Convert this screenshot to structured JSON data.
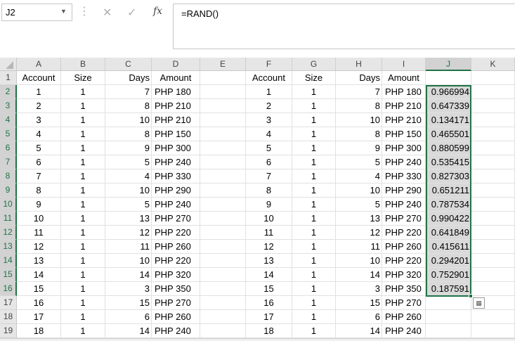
{
  "name_box": "J2",
  "formula": "=RAND()",
  "icons": {
    "cancel": "✕",
    "enter": "✓",
    "fx": "fx"
  },
  "columns": [
    "A",
    "B",
    "C",
    "D",
    "E",
    "F",
    "G",
    "H",
    "I",
    "J",
    "K"
  ],
  "headers": {
    "A": "Account",
    "B": "Size",
    "C": "Days",
    "D": "Amount",
    "F": "Account",
    "G": "Size",
    "H": "Days",
    "I": "Amount"
  },
  "rows": [
    {
      "n": "1",
      "A": "Account",
      "B": "Size",
      "C": "Days",
      "D": "Amount",
      "F": "Account",
      "G": "Size",
      "H": "Days",
      "I": "Amount",
      "J": ""
    },
    {
      "n": "2",
      "A": "1",
      "B": "1",
      "C": "7",
      "D": "PHP 180",
      "F": "1",
      "G": "1",
      "H": "7",
      "I": "PHP 180",
      "J": "0.966994"
    },
    {
      "n": "3",
      "A": "2",
      "B": "1",
      "C": "8",
      "D": "PHP 210",
      "F": "2",
      "G": "1",
      "H": "8",
      "I": "PHP 210",
      "J": "0.647339"
    },
    {
      "n": "4",
      "A": "3",
      "B": "1",
      "C": "10",
      "D": "PHP 210",
      "F": "3",
      "G": "1",
      "H": "10",
      "I": "PHP 210",
      "J": "0.134171"
    },
    {
      "n": "5",
      "A": "4",
      "B": "1",
      "C": "8",
      "D": "PHP 150",
      "F": "4",
      "G": "1",
      "H": "8",
      "I": "PHP 150",
      "J": "0.465501"
    },
    {
      "n": "6",
      "A": "5",
      "B": "1",
      "C": "9",
      "D": "PHP 300",
      "F": "5",
      "G": "1",
      "H": "9",
      "I": "PHP 300",
      "J": "0.880599"
    },
    {
      "n": "7",
      "A": "6",
      "B": "1",
      "C": "5",
      "D": "PHP 240",
      "F": "6",
      "G": "1",
      "H": "5",
      "I": "PHP 240",
      "J": "0.535415"
    },
    {
      "n": "8",
      "A": "7",
      "B": "1",
      "C": "4",
      "D": "PHP 330",
      "F": "7",
      "G": "1",
      "H": "4",
      "I": "PHP 330",
      "J": "0.827303"
    },
    {
      "n": "9",
      "A": "8",
      "B": "1",
      "C": "10",
      "D": "PHP 290",
      "F": "8",
      "G": "1",
      "H": "10",
      "I": "PHP 290",
      "J": "0.651211"
    },
    {
      "n": "10",
      "A": "9",
      "B": "1",
      "C": "5",
      "D": "PHP 240",
      "F": "9",
      "G": "1",
      "H": "5",
      "I": "PHP 240",
      "J": "0.787534"
    },
    {
      "n": "11",
      "A": "10",
      "B": "1",
      "C": "13",
      "D": "PHP 270",
      "F": "10",
      "G": "1",
      "H": "13",
      "I": "PHP 270",
      "J": "0.990422"
    },
    {
      "n": "12",
      "A": "11",
      "B": "1",
      "C": "12",
      "D": "PHP 220",
      "F": "11",
      "G": "1",
      "H": "12",
      "I": "PHP 220",
      "J": "0.641849"
    },
    {
      "n": "13",
      "A": "12",
      "B": "1",
      "C": "11",
      "D": "PHP 260",
      "F": "12",
      "G": "1",
      "H": "11",
      "I": "PHP 260",
      "J": "0.415611"
    },
    {
      "n": "14",
      "A": "13",
      "B": "1",
      "C": "10",
      "D": "PHP 220",
      "F": "13",
      "G": "1",
      "H": "10",
      "I": "PHP 220",
      "J": "0.294201"
    },
    {
      "n": "15",
      "A": "14",
      "B": "1",
      "C": "14",
      "D": "PHP 320",
      "F": "14",
      "G": "1",
      "H": "14",
      "I": "PHP 320",
      "J": "0.752901"
    },
    {
      "n": "16",
      "A": "15",
      "B": "1",
      "C": "3",
      "D": "PHP 350",
      "F": "15",
      "G": "1",
      "H": "3",
      "I": "PHP 350",
      "J": "0.187591"
    },
    {
      "n": "17",
      "A": "16",
      "B": "1",
      "C": "15",
      "D": "PHP 270",
      "F": "16",
      "G": "1",
      "H": "15",
      "I": "PHP 270",
      "J": ""
    },
    {
      "n": "18",
      "A": "17",
      "B": "1",
      "C": "6",
      "D": "PHP 260",
      "F": "17",
      "G": "1",
      "H": "6",
      "I": "PHP 260",
      "J": ""
    },
    {
      "n": "19",
      "A": "18",
      "B": "1",
      "C": "14",
      "D": "PHP 240",
      "F": "18",
      "G": "1",
      "H": "14",
      "I": "PHP 240",
      "J": ""
    }
  ],
  "selected_column": "J",
  "selected_rows": [
    "2",
    "3",
    "4",
    "5",
    "6",
    "7",
    "8",
    "9",
    "10",
    "11",
    "12",
    "13",
    "14",
    "15",
    "16"
  ]
}
